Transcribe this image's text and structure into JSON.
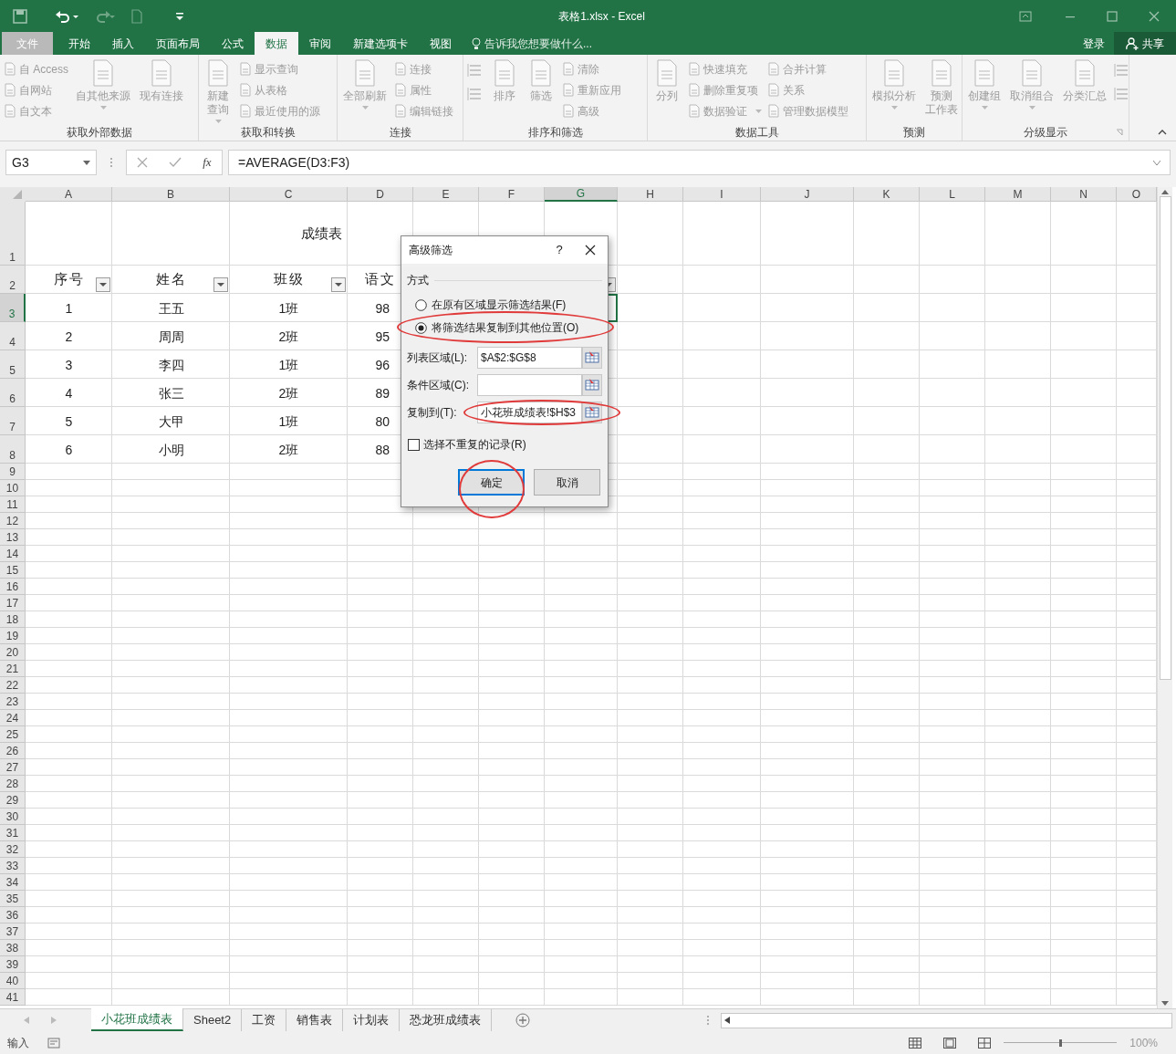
{
  "window": {
    "title": "表格1.xlsx - Excel"
  },
  "ribbon_tabs": [
    {
      "label": "文件",
      "selected": false,
      "kind": "file"
    },
    {
      "label": "开始",
      "selected": false
    },
    {
      "label": "插入",
      "selected": false
    },
    {
      "label": "页面布局",
      "selected": false
    },
    {
      "label": "公式",
      "selected": false
    },
    {
      "label": "数据",
      "selected": true
    },
    {
      "label": "审阅",
      "selected": false
    },
    {
      "label": "新建选项卡",
      "selected": false
    },
    {
      "label": "视图",
      "selected": false
    }
  ],
  "tell_me": "告诉我您想要做什么...",
  "sign_in": "登录",
  "share": "共享",
  "ribbon": {
    "disabled": true,
    "groups": [
      {
        "label": "获取外部数据",
        "columns": [
          [
            {
              "kind": "small",
              "label": "自 Access"
            },
            {
              "kind": "small",
              "label": "自网站"
            },
            {
              "kind": "small",
              "label": "自文本"
            }
          ],
          [
            {
              "kind": "large",
              "lines": [
                "自其他来源"
              ],
              "dropdown": true
            }
          ],
          [
            {
              "kind": "large",
              "lines": [
                "现有连接"
              ]
            }
          ]
        ]
      },
      {
        "label": "获取和转换",
        "columns": [
          [
            {
              "kind": "large",
              "lines": [
                "新建",
                "查询"
              ],
              "dropdown": true
            }
          ],
          [
            {
              "kind": "small",
              "label": "显示查询"
            },
            {
              "kind": "small",
              "label": "从表格"
            },
            {
              "kind": "small",
              "label": "最近使用的源"
            }
          ]
        ]
      },
      {
        "label": "连接",
        "columns": [
          [
            {
              "kind": "large",
              "lines": [
                "全部刷新"
              ],
              "dropdown": true
            }
          ],
          [
            {
              "kind": "small",
              "label": "连接"
            },
            {
              "kind": "small",
              "label": "属性"
            },
            {
              "kind": "small",
              "label": "编辑链接"
            }
          ]
        ]
      },
      {
        "label": "排序和筛选",
        "columns": [
          [
            {
              "kind": "icon"
            },
            {
              "kind": "icon"
            }
          ],
          [
            {
              "kind": "large",
              "lines": [
                "排序"
              ]
            }
          ],
          [
            {
              "kind": "large",
              "lines": [
                "筛选"
              ]
            }
          ],
          [
            {
              "kind": "small",
              "label": "清除"
            },
            {
              "kind": "small",
              "label": "重新应用"
            },
            {
              "kind": "small",
              "label": "高级"
            }
          ]
        ]
      },
      {
        "label": "数据工具",
        "columns": [
          [
            {
              "kind": "large",
              "lines": [
                "分列"
              ]
            }
          ],
          [
            {
              "kind": "small",
              "label": "快速填充"
            },
            {
              "kind": "small",
              "label": "删除重复项"
            },
            {
              "kind": "small",
              "label": "数据验证",
              "dropdown": true
            }
          ],
          [
            {
              "kind": "small",
              "label": "合并计算"
            },
            {
              "kind": "small",
              "label": "关系"
            },
            {
              "kind": "small",
              "label": "管理数据模型"
            }
          ]
        ]
      },
      {
        "label": "预测",
        "columns": [
          [
            {
              "kind": "large",
              "lines": [
                "模拟分析"
              ],
              "dropdown": true
            }
          ],
          [
            {
              "kind": "large",
              "lines": [
                "预测",
                "工作表"
              ]
            }
          ]
        ]
      },
      {
        "label": "分级显示",
        "launcher": true,
        "columns": [
          [
            {
              "kind": "large",
              "lines": [
                "创建组"
              ],
              "dropdown": true
            }
          ],
          [
            {
              "kind": "large",
              "lines": [
                "取消组合"
              ],
              "dropdown": true
            }
          ],
          [
            {
              "kind": "large",
              "lines": [
                "分类汇总"
              ]
            }
          ],
          [
            {
              "kind": "icon"
            },
            {
              "kind": "icon"
            }
          ]
        ]
      }
    ]
  },
  "name_box": "G3",
  "fx": "fx",
  "formula": "=AVERAGE(D3:F3)",
  "columns": [
    {
      "label": "A",
      "selected": false
    },
    {
      "label": "B",
      "selected": false
    },
    {
      "label": "C",
      "selected": false
    },
    {
      "label": "D",
      "selected": false
    },
    {
      "label": "E",
      "selected": false
    },
    {
      "label": "F",
      "selected": false
    },
    {
      "label": "G",
      "selected": true
    },
    {
      "label": "H",
      "selected": false
    },
    {
      "label": "I",
      "selected": false
    },
    {
      "label": "J",
      "selected": false
    },
    {
      "label": "K",
      "selected": false
    },
    {
      "label": "L",
      "selected": false
    },
    {
      "label": "M",
      "selected": false
    },
    {
      "label": "N",
      "selected": false
    },
    {
      "label": "O",
      "selected": false
    }
  ],
  "rows": [
    {
      "label": "1",
      "selected": false
    },
    {
      "label": "2",
      "selected": false
    },
    {
      "label": "3",
      "selected": true
    },
    {
      "label": "4",
      "selected": false
    },
    {
      "label": "5",
      "selected": false
    },
    {
      "label": "6",
      "selected": false
    },
    {
      "label": "7",
      "selected": false
    },
    {
      "label": "8",
      "selected": false
    },
    {
      "label": "9",
      "selected": false
    },
    {
      "label": "10",
      "selected": false
    },
    {
      "label": "11",
      "selected": false
    },
    {
      "label": "12",
      "selected": false
    },
    {
      "label": "13",
      "selected": false
    },
    {
      "label": "14",
      "selected": false
    },
    {
      "label": "15",
      "selected": false
    },
    {
      "label": "16",
      "selected": false
    },
    {
      "label": "17",
      "selected": false
    },
    {
      "label": "18",
      "selected": false
    },
    {
      "label": "19",
      "selected": false
    },
    {
      "label": "20",
      "selected": false
    },
    {
      "label": "21",
      "selected": false
    },
    {
      "label": "22",
      "selected": false
    },
    {
      "label": "23",
      "selected": false
    },
    {
      "label": "24",
      "selected": false
    },
    {
      "label": "25",
      "selected": false
    },
    {
      "label": "26",
      "selected": false
    },
    {
      "label": "27",
      "selected": false
    },
    {
      "label": "28",
      "selected": false
    },
    {
      "label": "29",
      "selected": false
    },
    {
      "label": "30",
      "selected": false
    },
    {
      "label": "31",
      "selected": false
    },
    {
      "label": "32",
      "selected": false
    },
    {
      "label": "33",
      "selected": false
    },
    {
      "label": "34",
      "selected": false
    },
    {
      "label": "35",
      "selected": false
    },
    {
      "label": "36",
      "selected": false
    },
    {
      "label": "37",
      "selected": false
    },
    {
      "label": "38",
      "selected": false
    },
    {
      "label": "39",
      "selected": false
    },
    {
      "label": "40",
      "selected": false
    },
    {
      "label": "41",
      "selected": false
    }
  ],
  "sheet": {
    "title": "成绩表",
    "headers": [
      "序号",
      "姓名",
      "班级",
      "语文"
    ],
    "rows": [
      [
        "1",
        "王五",
        "1班",
        "98"
      ],
      [
        "2",
        "周周",
        "2班",
        "95"
      ],
      [
        "3",
        "李四",
        "1班",
        "96"
      ],
      [
        "4",
        "张三",
        "2班",
        "89"
      ],
      [
        "5",
        "大甲",
        "1班",
        "80"
      ],
      [
        "6",
        "小明",
        "2班",
        "88"
      ]
    ]
  },
  "dialog": {
    "title": "高级筛选",
    "help": "?",
    "section": "方式",
    "options": [
      {
        "label": "在原有区域显示筛选结果(F)",
        "selected": false,
        "highlighted": false
      },
      {
        "label": "将筛选结果复制到其他位置(O)",
        "selected": true,
        "highlighted": true
      }
    ],
    "fields": [
      {
        "label": "列表区域(L):",
        "value": "$A$2:$G$8",
        "highlighted": false
      },
      {
        "label": "条件区域(C):",
        "highlighted": false
      },
      {
        "label": "复制到(T):",
        "value": "小花班成绩表!$H$3",
        "highlighted": true
      }
    ],
    "unique": {
      "label": "选择不重复的记录(R)",
      "checked": false
    },
    "buttons": [
      {
        "label": "确定",
        "kind": "primary",
        "highlighted": true
      },
      {
        "label": "取消",
        "kind": "normal",
        "highlighted": false
      }
    ]
  },
  "sheet_tabs": [
    {
      "label": "小花班成绩表",
      "selected": true
    },
    {
      "label": "Sheet2",
      "selected": false
    },
    {
      "label": "工资",
      "selected": false
    },
    {
      "label": "销售表",
      "selected": false
    },
    {
      "label": "计划表",
      "selected": false
    },
    {
      "label": "恐龙班成绩表",
      "selected": false
    }
  ],
  "status": "输入",
  "zoom_slider": {
    "level": 0.5
  },
  "zoom": "100%"
}
